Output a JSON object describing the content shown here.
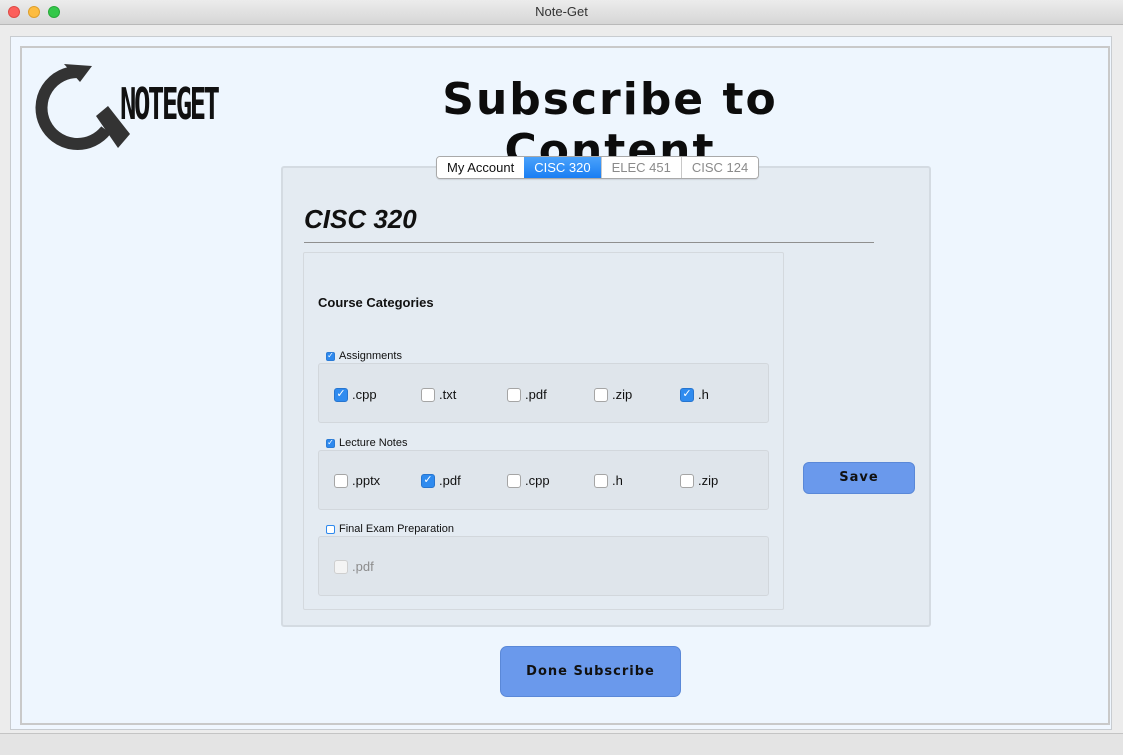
{
  "window": {
    "title": "Note-Get"
  },
  "logo": {
    "text": "NOTEGET",
    "icon": "refresh-q-icon"
  },
  "page_title": "Subscribe to Content",
  "tabs": [
    {
      "label": "My Account",
      "active": false
    },
    {
      "label": "CISC 320",
      "active": true
    },
    {
      "label": "ELEC 451",
      "active": false
    },
    {
      "label": "CISC 124",
      "active": false
    }
  ],
  "course": {
    "title": "CISC 320",
    "categories_heading": "Course Categories",
    "groups": [
      {
        "label": "Assignments",
        "checked": true,
        "options": [
          {
            "label": ".cpp",
            "checked": true
          },
          {
            "label": ".txt",
            "checked": false
          },
          {
            "label": ".pdf",
            "checked": false
          },
          {
            "label": ".zip",
            "checked": false
          },
          {
            "label": ".h",
            "checked": true
          }
        ]
      },
      {
        "label": "Lecture Notes",
        "checked": true,
        "options": [
          {
            "label": ".pptx",
            "checked": false
          },
          {
            "label": ".pdf",
            "checked": true
          },
          {
            "label": ".cpp",
            "checked": false
          },
          {
            "label": ".h",
            "checked": false
          },
          {
            "label": ".zip",
            "checked": false
          }
        ]
      },
      {
        "label": "Final Exam Preparation",
        "checked": false,
        "options": [
          {
            "label": ".pdf",
            "checked": false,
            "disabled": true
          }
        ]
      }
    ]
  },
  "buttons": {
    "save": "Save",
    "done": "Done Subscribe"
  },
  "colors": {
    "accent": "#2f8bef",
    "button": "#6a99ec",
    "panel": "#eef6fe"
  }
}
